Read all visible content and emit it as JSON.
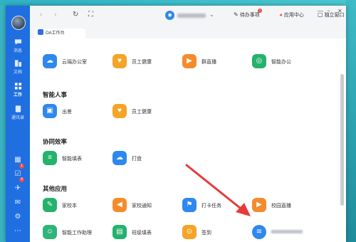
{
  "nav": {
    "items": [
      {
        "label": "消息",
        "icon": "chat-icon"
      },
      {
        "label": "文档",
        "icon": "document-icon"
      },
      {
        "label": "工作",
        "icon": "grid-icon"
      },
      {
        "label": "通讯录",
        "icon": "contacts-icon"
      }
    ],
    "badges": [
      "1",
      "9"
    ]
  },
  "titlebar": {
    "todo": "待办事项",
    "todo_badge": "1",
    "app_center": "应用中心",
    "standalone": "独立窗口"
  },
  "tab": {
    "label": "OA工作台"
  },
  "sections": {
    "top": [
      {
        "name": "云端办公室",
        "color": "#2e88ee",
        "icon": "cloud-icon"
      },
      {
        "name": "员工健康",
        "color": "#f5a428",
        "icon": "heart-icon"
      },
      {
        "name": "群直播",
        "color": "#f58b2c",
        "icon": "live-icon"
      },
      {
        "name": "智能办公",
        "color": "#24b26c",
        "icon": "smart-office-icon"
      }
    ],
    "hr_title": "智能人事",
    "hr": [
      {
        "name": "出差",
        "color": "#2e88ee",
        "icon": "briefcase-icon"
      },
      {
        "name": "员工健康",
        "color": "#f5a428",
        "icon": "heart-icon"
      }
    ],
    "collab_title": "协同效率",
    "collab": [
      {
        "name": "智能填表",
        "color": "#24b26c",
        "icon": "form-icon"
      },
      {
        "name": "打盘",
        "color": "#2e88ee",
        "icon": "cloud-disk-icon"
      }
    ],
    "other_title": "其他应用",
    "other": [
      {
        "name": "家校本",
        "color": "#24b26c",
        "icon": "notebook-icon"
      },
      {
        "name": "家校通知",
        "color": "#f58b2c",
        "icon": "megaphone-icon"
      },
      {
        "name": "打卡任务",
        "color": "#2e88ee",
        "icon": "checkin-icon"
      },
      {
        "name": "校园直播",
        "color": "#f58b2c",
        "icon": "campus-live-icon"
      },
      {
        "name": "智能工作助理",
        "color": "#2fb57a",
        "icon": "assistant-icon"
      },
      {
        "name": "班级填表",
        "color": "#24b26c",
        "icon": "class-form-icon"
      },
      {
        "name": "签到",
        "color": "#f5a428",
        "icon": "location-pin-icon"
      },
      {
        "name": "",
        "color": "#2e88ee",
        "icon": "stack-icon"
      }
    ]
  },
  "accent": "#1f6fe0",
  "arrow_color": "#e63b3b"
}
